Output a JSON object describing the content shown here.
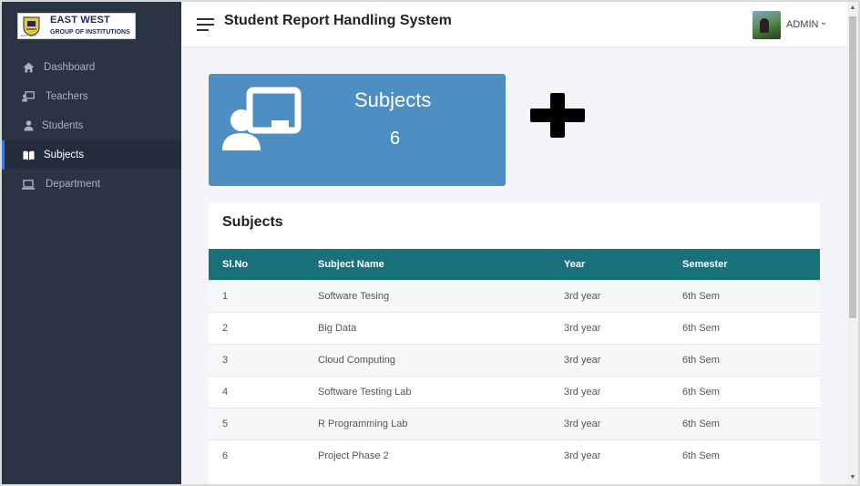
{
  "brand": {
    "name_line1": "EAST WEST",
    "name_line2": "GROUP OF INSTITUTIONS",
    "crest_caption": "EAST WEST"
  },
  "sidebar": {
    "items": [
      {
        "label": "Dashboard",
        "icon": "home-icon",
        "active": false
      },
      {
        "label": "Teachers",
        "icon": "chalkboard-teacher-icon",
        "active": false
      },
      {
        "label": "Students",
        "icon": "user-icon",
        "active": false
      },
      {
        "label": "Subjects",
        "icon": "book-open-icon",
        "active": true
      },
      {
        "label": "Department",
        "icon": "laptop-icon",
        "active": false
      }
    ]
  },
  "header": {
    "title": "Student Report Handling System",
    "user_label": "ADMIN",
    "user_caret": "⌄"
  },
  "stat_card": {
    "title": "Subjects",
    "value": "6",
    "icon": "chalkboard-teacher-icon",
    "color": "#4e8fc3"
  },
  "add_button": {
    "icon": "plus-icon"
  },
  "subjects_table": {
    "title": "Subjects",
    "header_color": "#17707a",
    "columns": [
      "Sl.No",
      "Subject Name",
      "Year",
      "Semester"
    ],
    "rows": [
      [
        "1",
        "Software Tesing",
        "3rd year",
        "6th Sem"
      ],
      [
        "2",
        "Big Data",
        "3rd year",
        "6th Sem"
      ],
      [
        "3",
        "Cloud Computing",
        "3rd year",
        "6th Sem"
      ],
      [
        "4",
        "Software Testing Lab",
        "3rd year",
        "6th Sem"
      ],
      [
        "5",
        "R Programming Lab",
        "3rd year",
        "6th Sem"
      ],
      [
        "6",
        "Project Phase 2",
        "3rd year",
        "6th Sem"
      ]
    ]
  },
  "scrollbar": {
    "up_arrow": "▲",
    "down_arrow": "▼"
  }
}
